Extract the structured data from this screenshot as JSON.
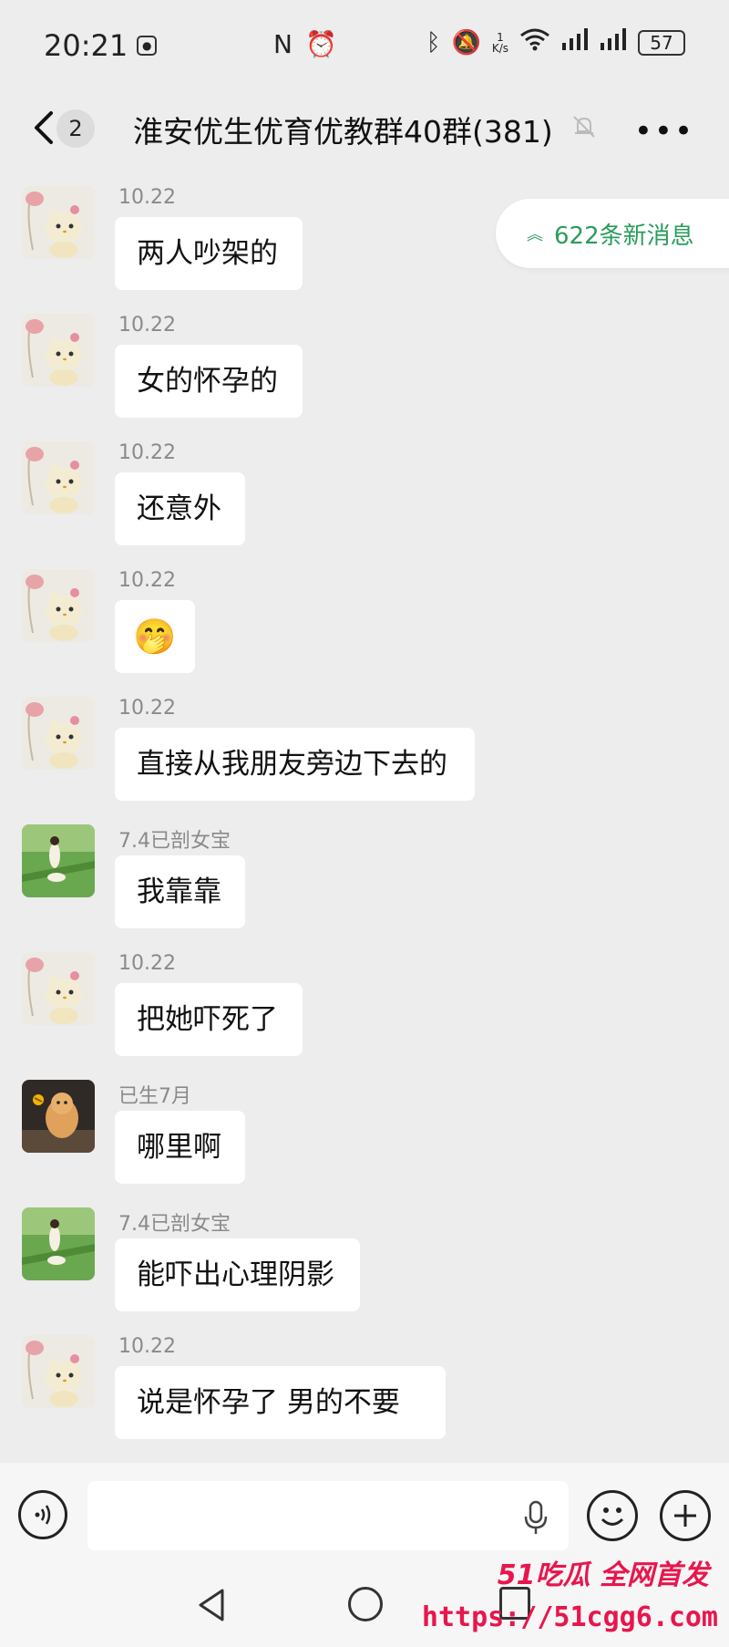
{
  "status_bar": {
    "time": "20:21",
    "speed_top": "1",
    "speed_unit": "K/s",
    "battery": "57"
  },
  "header": {
    "unread_count": "2",
    "title": "淮安优生优育优教群40群(381)"
  },
  "new_messages_pill": "622条新消息",
  "messages": [
    {
      "sender": "10.22",
      "text": "两人吵架的",
      "avatar": "cat"
    },
    {
      "sender": "10.22",
      "text": "女的怀孕的",
      "avatar": "cat"
    },
    {
      "sender": "10.22",
      "text": "还意外",
      "avatar": "cat"
    },
    {
      "sender": "10.22",
      "text": "",
      "emoji": "🤭",
      "avatar": "cat"
    },
    {
      "sender": "10.22",
      "text": "直接从我朋友旁边下去的",
      "avatar": "cat"
    },
    {
      "sender": "7.4已剖女宝",
      "text": "我靠靠",
      "avatar": "grass"
    },
    {
      "sender": "10.22",
      "text": "把她吓死了",
      "avatar": "cat"
    },
    {
      "sender": "已生7月",
      "text": "哪里啊",
      "avatar": "dog"
    },
    {
      "sender": "7.4已剖女宝",
      "text": "能吓出心理阴影",
      "avatar": "grass"
    },
    {
      "sender": "10.22",
      "text": "说是怀孕了 男的不要",
      "avatar": "cat"
    }
  ],
  "input": {
    "placeholder": ""
  },
  "watermark": {
    "brand": "51吃瓜 全网首发",
    "url": "https://51cgg6.com"
  },
  "colors": {
    "accent_green": "#2a9c5c",
    "watermark_red": "#e8164d",
    "background": "#ededed"
  }
}
